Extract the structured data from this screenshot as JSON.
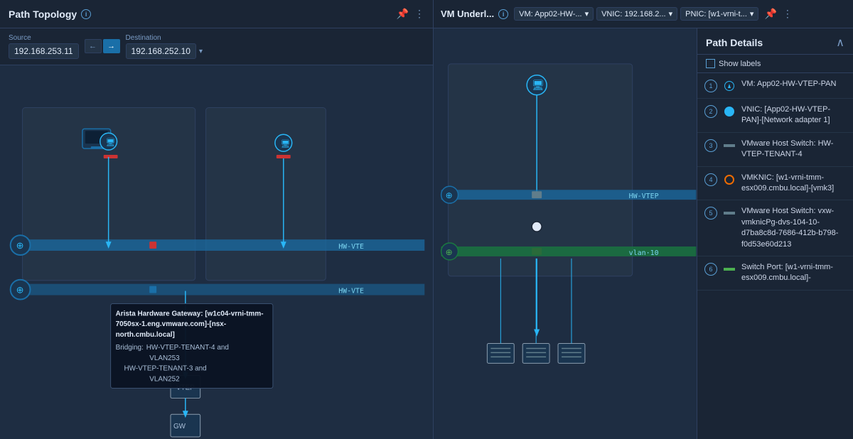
{
  "left_panel": {
    "title": "Path Topology",
    "source_label": "Source",
    "source_value": "192.168.253.11",
    "dest_label": "Destination",
    "dest_value": "192.168.252.10",
    "dir_back": "←",
    "dir_fwd": "→"
  },
  "right_panel": {
    "title": "VM Underl...",
    "breadcrumbs": [
      {
        "label": "VM: App02-HW-..."
      },
      {
        "label": "VNIC: 192.168.2..."
      },
      {
        "label": "PNIC: [w1-vrni-t..."
      }
    ]
  },
  "path_details": {
    "title": "Path Details",
    "show_labels": "Show labels",
    "items": [
      {
        "num": "1",
        "type": "vm",
        "text": "VM: App02-HW-VTEP-PAN"
      },
      {
        "num": "2",
        "type": "vnic",
        "text": "VNIC: [App02-HW-VTEP-PAN]-[Network adapter 1]"
      },
      {
        "num": "3",
        "type": "switch",
        "text": "VMware Host Switch: HW-VTEP-TENANT-4"
      },
      {
        "num": "4",
        "type": "vmknic",
        "text": "VMKNIC: [w1-vrni-tmm-esx009.cmbu.local]-[vmk3]"
      },
      {
        "num": "5",
        "type": "switch",
        "text": "VMware Host Switch: vxw-vmknicPg-dvs-104-10-d7ba8c8d-7686-412b-b798-f0d53e60d213"
      },
      {
        "num": "6",
        "type": "port",
        "text": "Switch Port: [w1-vrni-tmm-esx009.cmbu.local]-"
      }
    ]
  },
  "tooltip": {
    "title": "Arista Hardware Gateway: [w1c04-vrni-tmm-7050sx-1.eng.vmware.com]-[nsx-north.cmbu.local]",
    "bridging_label": "Bridging:",
    "bridging_items": [
      "HW-VTEP-TENANT-4 and VLAN253",
      "HW-VTEP-TENANT-3 and VLAN252"
    ]
  },
  "labels": {
    "hw_vtep1": "HW-VTE",
    "hw_vtep2": "HW-VTE",
    "hw_vtep_right": "HW-VTEP",
    "vlan10": "vlan·10"
  },
  "icons": {
    "info": "i",
    "pin": "📌",
    "more": "⋮",
    "collapse": "∧",
    "chevron": "▾"
  }
}
